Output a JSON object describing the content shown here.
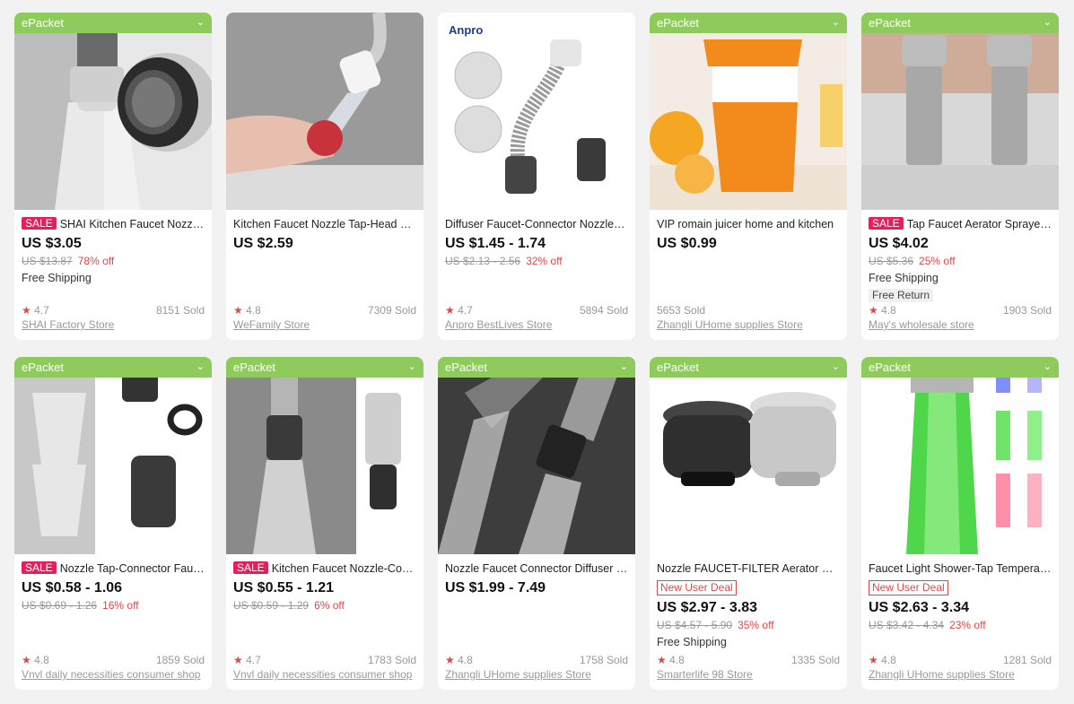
{
  "badge_label": "ePacket",
  "sale_label": "SALE",
  "newuser_label": "New User Deal",
  "free_shipping_label": "Free Shipping",
  "free_return_label": "Free Return",
  "logo_anpro": "Anpro",
  "accent": {
    "badge": "#8fcb5c",
    "sale": "#e3205a",
    "discount": "#e64545"
  },
  "products": [
    {
      "badge": true,
      "sale": false,
      "title": "SHAI Kitchen Faucet Nozzle Adapter",
      "price": "US $3.05",
      "orig": "US $13.87",
      "off": "78% off",
      "shipping": true,
      "rating": "4.7",
      "sold": "8151 Sold",
      "store": "SHAI Factory Store"
    },
    {
      "badge": false,
      "title": "Kitchen Faucet Nozzle Tap-Head Sprayer",
      "price": "US $2.59",
      "rating": "4.8",
      "sold": "7309 Sold",
      "store": "WeFamily Store"
    },
    {
      "badge": false,
      "title": "Diffuser Faucet-Connector Nozzle Filter",
      "price": "US $1.45 - 1.74",
      "orig": "US $2.13 - 2.56",
      "off": "32% off",
      "rating": "4.7",
      "sold": "5894 Sold",
      "store": "Anpro BestLives Store"
    },
    {
      "badge": true,
      "title": "VIP romain juicer home and kitchen",
      "price": "US $0.99",
      "sold": "5653 Sold",
      "store": "Zhangli UHome supplies Store"
    },
    {
      "badge": true,
      "title": "Tap Faucet Aerator Sprayer Nozzle",
      "price": "US $4.02",
      "orig": "US $5.36",
      "off": "25% off",
      "shipping": true,
      "ret": true,
      "rating": "4.8",
      "sold": "1903 Sold",
      "store": "May's wholesale store"
    },
    {
      "badge": true,
      "title": "Nozzle Tap-Connector Faucet Aerator",
      "price": "US $0.58 - 1.06",
      "orig": "US $0.69 - 1.26",
      "off": "16% off",
      "rating": "4.8",
      "sold": "1859 Sold",
      "store": "Vnvl daily necessities consumer shop"
    },
    {
      "badge": true,
      "title": "Kitchen Faucet Nozzle-Connector Adapter",
      "price": "US $0.55 - 1.21",
      "orig": "US $0.59 - 1.29",
      "off": "6% off",
      "rating": "4.7",
      "sold": "1783 Sold",
      "store": "Vnvl daily necessities consumer shop"
    },
    {
      "badge": true,
      "title": "Nozzle Faucet Connector Diffuser Swivel",
      "price": "US $1.99 - 7.49",
      "rating": "4.8",
      "sold": "1758 Sold",
      "store": "Zhangli UHome supplies Store"
    },
    {
      "badge": true,
      "title": "Nozzle FAUCET-FILTER Aerator Kitchen",
      "price": "US $2.97 - 3.83",
      "orig": "US $4.57 - 5.90",
      "off": "35% off",
      "shipping": true,
      "rating": "4.8",
      "sold": "1335 Sold",
      "store": "Smarterlife 98 Store"
    },
    {
      "badge": true,
      "title": "Faucet Light Shower-Tap Temperature LED",
      "price": "US $2.63 - 3.34",
      "orig": "US $3.42 - 4.34",
      "off": "23% off",
      "rating": "4.8",
      "sold": "1281 Sold",
      "store": "Zhangli UHome supplies Store"
    }
  ]
}
